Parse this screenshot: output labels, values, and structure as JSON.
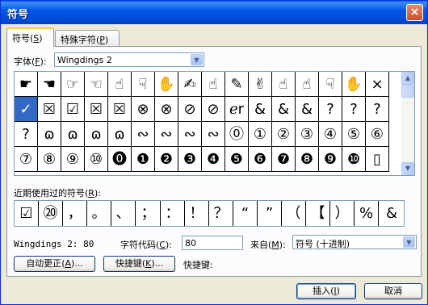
{
  "window": {
    "title": "符号",
    "close_glyph": "×"
  },
  "tabs": [
    {
      "label": "符号",
      "key": "S",
      "active": true
    },
    {
      "label": "特殊字符",
      "key": "P",
      "active": false
    }
  ],
  "font": {
    "label": "字体",
    "key": "F",
    "value": "Wingdings 2",
    "arrow": "▼"
  },
  "symbol_grid": {
    "selected_index": 16,
    "rows": [
      [
        "☛",
        "☚",
        "☞",
        "☜",
        "☝",
        "☟",
        "✋",
        "✍",
        "☝",
        "✎",
        "✌",
        "☝",
        "☝",
        "☟",
        "✋",
        "×"
      ],
      [
        "✓",
        "☒",
        "☑",
        "☒",
        "☒",
        "⊗",
        "⊗",
        "⊘",
        "⊘",
        "ℯr",
        "&",
        "&",
        "&",
        "?",
        "?",
        "?"
      ],
      [
        "?",
        "ɷ",
        "ɷ",
        "ɷ",
        "ɷ",
        "∾",
        "∾",
        "∾",
        "∾",
        "⓪",
        "①",
        "②",
        "③",
        "④",
        "⑤",
        "⑥"
      ],
      [
        "⑦",
        "⑧",
        "⑨",
        "⑩",
        "⓿",
        "❶",
        "❷",
        "❸",
        "❹",
        "❺",
        "❻",
        "❼",
        "❽",
        "❾",
        "❿",
        "▯"
      ]
    ],
    "scroll": {
      "up": "▲",
      "down": "▼"
    }
  },
  "recent": {
    "label": "近期使用过的符号",
    "key": "R",
    "items": [
      "☑",
      "⑳",
      "，",
      "。",
      "、",
      "；",
      "：",
      "！",
      "？",
      "“",
      "”",
      "（",
      "【",
      "）",
      "%",
      "&"
    ]
  },
  "info": {
    "name": "Wingdings 2: 80"
  },
  "char_code": {
    "label": "字符代码",
    "key": "C",
    "value": "80"
  },
  "from": {
    "label": "来自",
    "key": "M",
    "value": "符号 (十进制)",
    "arrow": "▼"
  },
  "buttons": {
    "autocorrect": {
      "label": "自动更正",
      "key": "A",
      "suffix": "..."
    },
    "shortcut": {
      "label": "快捷键",
      "key": "K",
      "suffix": "..."
    },
    "shortcut_text": "快捷键:",
    "insert": {
      "label": "插入",
      "key": "I"
    },
    "cancel": {
      "label": "取消"
    }
  }
}
